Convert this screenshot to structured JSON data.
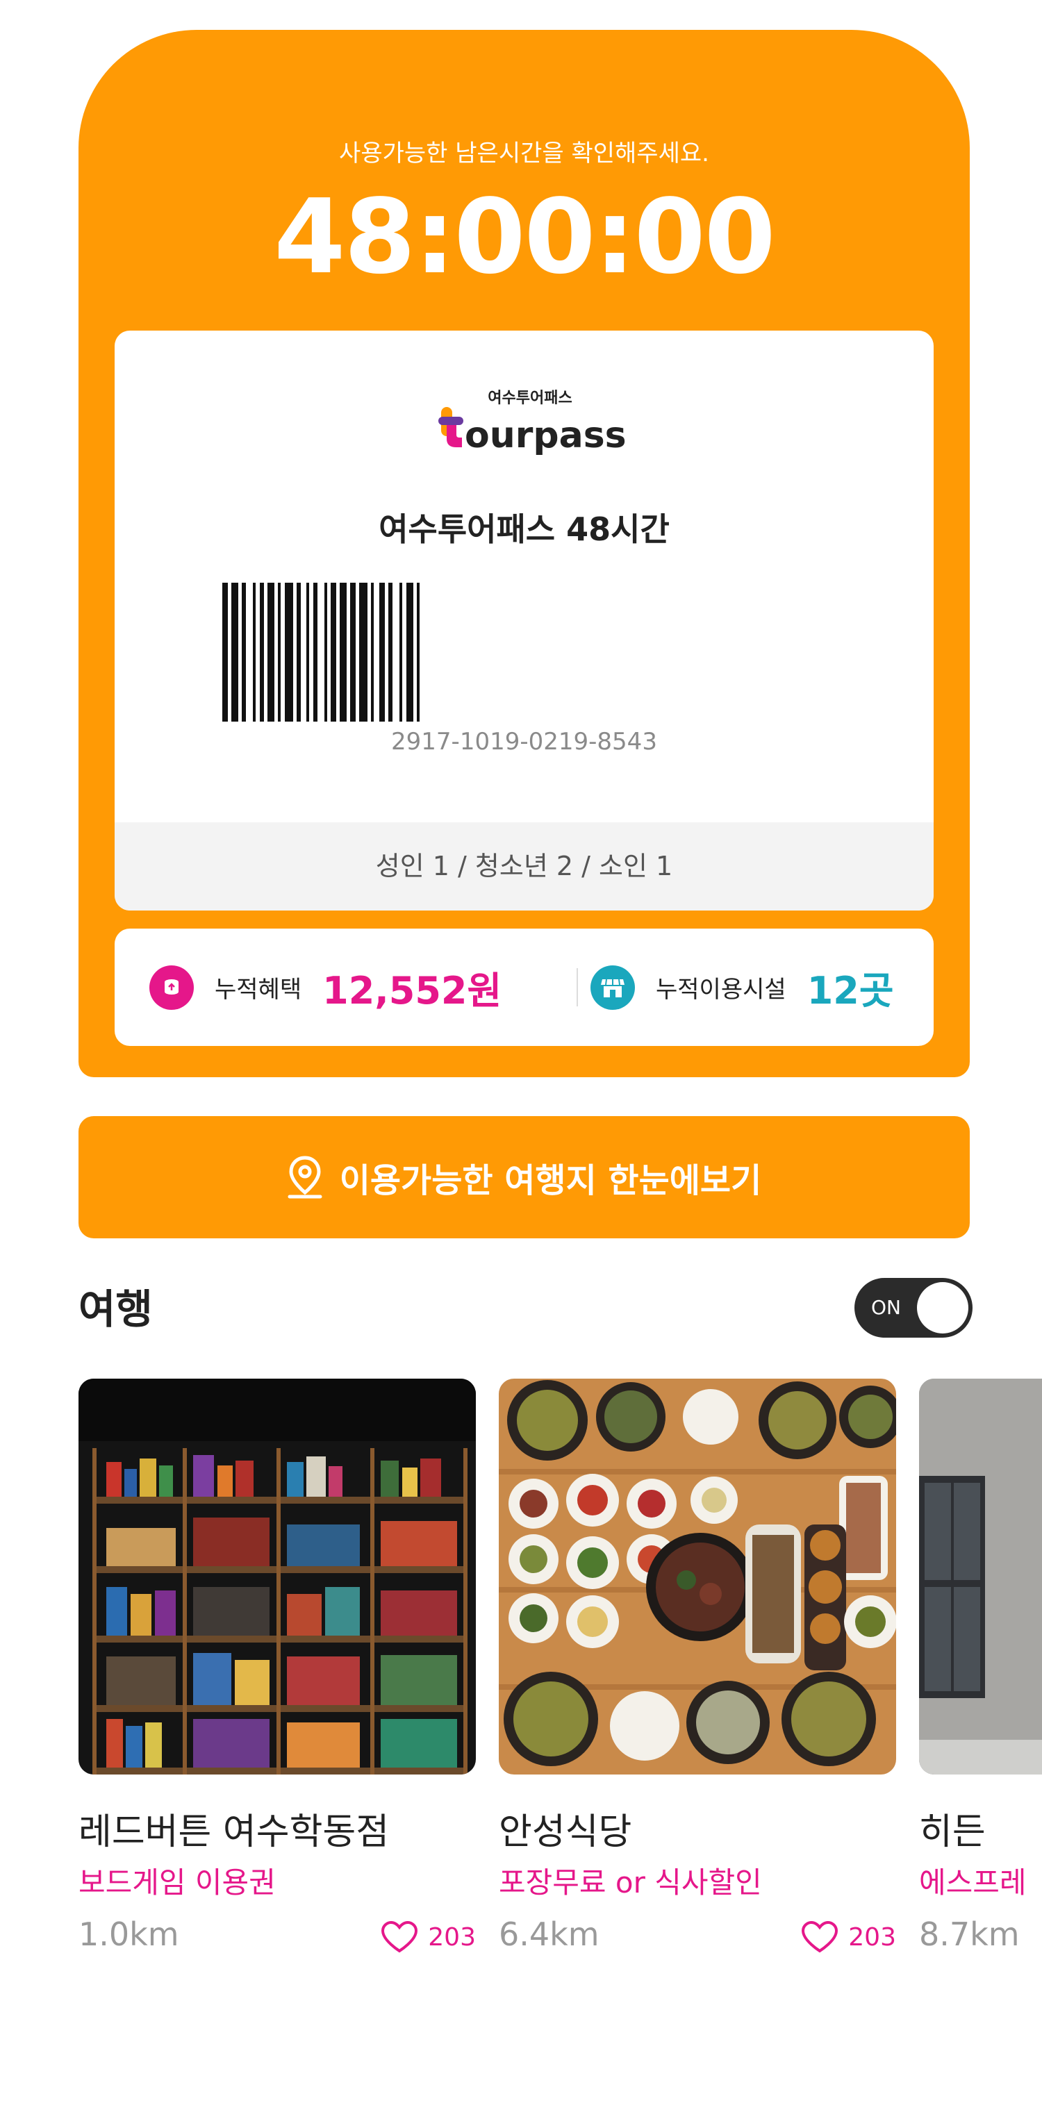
{
  "pass": {
    "subtitle": "사용가능한 남은시간을 확인해주세요.",
    "remaining_time": "48:00:00",
    "logo_caption": "여수투어패스",
    "logo_wordmark": "tourpass",
    "ticket_title": "여수투어패스 48시간",
    "barcode_number": "2917-1019-0219-8543",
    "passengers": "성인 1 / 청소년 2 / 소인 1"
  },
  "stats": {
    "benefit_label": "누적혜택",
    "benefit_value": "12,552원",
    "benefit_icon": "coins-icon",
    "facility_label": "누적이용시설",
    "facility_value": "12곳",
    "facility_icon": "store-icon"
  },
  "cta": {
    "label": "이용가능한 여행지 한눈에보기",
    "icon": "map-pin-icon"
  },
  "section": {
    "title": "여행",
    "toggle_label": "ON",
    "toggle_on": true
  },
  "places": [
    {
      "name": "레드버튼 여수학동점",
      "benefit": "보드게임 이용권",
      "distance": "1.0km",
      "likes": "203"
    },
    {
      "name": "안성식당",
      "benefit": "포장무료 or 식사할인",
      "distance": "6.4km",
      "likes": "203"
    },
    {
      "name": "히든",
      "benefit": "에스프레",
      "distance": "8.7km",
      "likes": ""
    }
  ],
  "colors": {
    "brand_orange": "#FF9A05",
    "accent_pink": "#E5178A",
    "accent_teal": "#1AA7BD"
  }
}
